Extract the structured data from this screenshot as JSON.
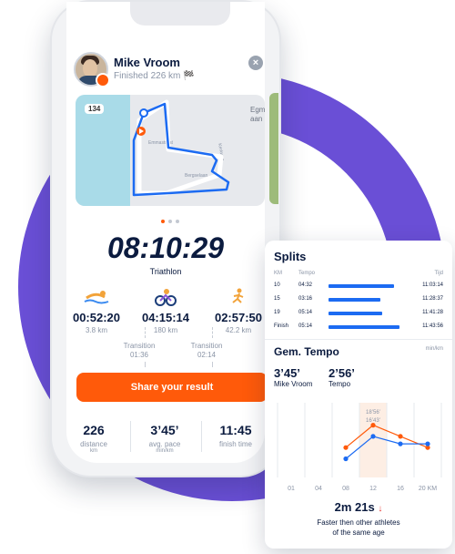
{
  "app": {
    "user_name": "Mike Vroom",
    "finished_text": "Finished 226 km 🏁",
    "map": {
      "road_badge": "134",
      "place_label": "Egm aan",
      "street_1": "Emmastraat",
      "street_2": "Kerkweg",
      "street_3": "Bergselaan"
    },
    "total_time": "08:10:29",
    "sport": "Triathlon",
    "segments": [
      {
        "icon": "swim-icon",
        "time": "00:52:20",
        "distance": "3.8 km"
      },
      {
        "icon": "bike-icon",
        "time": "04:15:14",
        "distance": "180 km"
      },
      {
        "icon": "run-icon",
        "time": "02:57:50",
        "distance": "42.2 km"
      }
    ],
    "transitions": [
      {
        "label": "Transition",
        "time": "01:36"
      },
      {
        "label": "Transition",
        "time": "02:14"
      }
    ],
    "share_label": "Share your result",
    "stats": [
      {
        "value": "226",
        "label": "distance",
        "unit": "km"
      },
      {
        "value": "3’45’",
        "label": "avg. pace",
        "unit": "min/km"
      },
      {
        "value": "11:45",
        "label": "finish time",
        "unit": ""
      }
    ]
  },
  "splits": {
    "title": "Splits",
    "headers": {
      "km": "KM",
      "tempo": "Tempo",
      "tijd": "Tijd"
    },
    "rows": [
      {
        "km": "10",
        "tempo": "04:32",
        "fraction": 0.55,
        "tijd": "11:03:14"
      },
      {
        "km": "15",
        "tempo": "03:16",
        "fraction": 0.44,
        "tijd": "11:28:37"
      },
      {
        "km": "19",
        "tempo": "05:14",
        "fraction": 0.45,
        "tijd": "11:41:28"
      },
      {
        "km": "Finish",
        "tempo": "05:14",
        "fraction": 0.6,
        "tijd": "11:43:56"
      }
    ]
  },
  "tempo": {
    "title": "Gem. Tempo",
    "unit": "min/km",
    "mine": {
      "value": "3’45’",
      "label": "Mike Vroom"
    },
    "other": {
      "value": "2’56’",
      "label": "Tempo"
    },
    "callout_1": "18’56’",
    "callout_2": "16’43’",
    "result": "2m 21s",
    "result_arrow": "↓",
    "result_sub_1": "Faster then other athletes",
    "result_sub_2": "of the same age"
  },
  "colors": {
    "accent": "#ff5a0a",
    "ring": "#6a4fd6",
    "blue": "#1c6bf2",
    "navy": "#0b1b3f"
  },
  "chart_data": {
    "type": "line",
    "categories": [
      "01",
      "04",
      "08",
      "12",
      "16",
      "20 KM"
    ],
    "series": [
      {
        "values": [
          null,
          null,
          3.6,
          4.8,
          4.2,
          3.6
        ],
        "color": "#ff5a0a"
      },
      {
        "values": [
          null,
          null,
          3.0,
          4.2,
          3.8,
          3.8
        ],
        "color": "#1c6bf2"
      }
    ],
    "ylim": [
      2,
      6
    ],
    "grid": true
  }
}
